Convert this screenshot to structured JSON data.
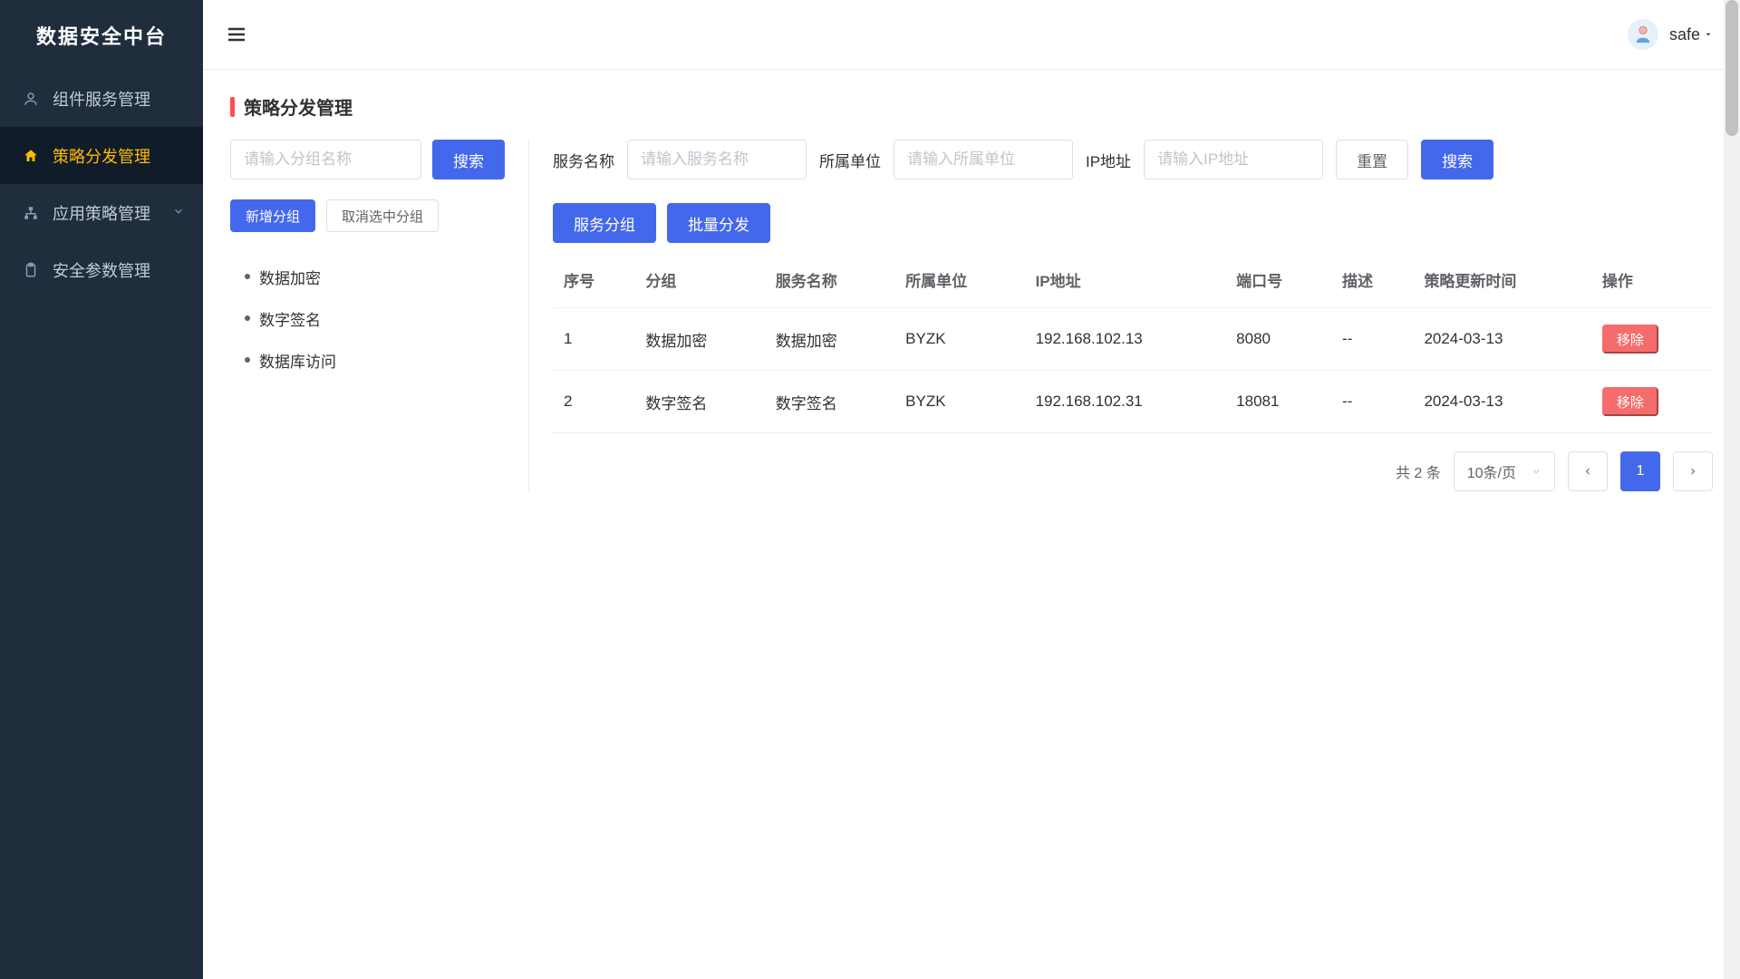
{
  "app_title": "数据安全中台",
  "user": {
    "name": "safe"
  },
  "sidebar": {
    "items": [
      {
        "label": "组件服务管理",
        "icon": "users-icon",
        "active": false,
        "expandable": false
      },
      {
        "label": "策略分发管理",
        "icon": "home-icon",
        "active": true,
        "expandable": false
      },
      {
        "label": "应用策略管理",
        "icon": "sitemap-icon",
        "active": false,
        "expandable": true
      },
      {
        "label": "安全参数管理",
        "icon": "clipboard-icon",
        "active": false,
        "expandable": false
      }
    ]
  },
  "page_title": "策略分发管理",
  "left_panel": {
    "search_placeholder": "请输入分组名称",
    "search_button": "搜索",
    "add_button": "新增分组",
    "cancel_button": "取消选中分组",
    "groups": [
      {
        "label": "数据加密"
      },
      {
        "label": "数字签名"
      },
      {
        "label": "数据库访问"
      }
    ]
  },
  "filters": {
    "service_label": "服务名称",
    "service_placeholder": "请输入服务名称",
    "unit_label": "所属单位",
    "unit_placeholder": "请输入所属单位",
    "ip_label": "IP地址",
    "ip_placeholder": "请输入IP地址",
    "reset_button": "重置",
    "search_button": "搜索"
  },
  "actions": {
    "group_service_button": "服务分组",
    "bulk_dispatch_button": "批量分发"
  },
  "table": {
    "headers": [
      "序号",
      "分组",
      "服务名称",
      "所属单位",
      "IP地址",
      "端口号",
      "描述",
      "策略更新时间",
      "操作"
    ],
    "rows": [
      {
        "seq": "1",
        "group": "数据加密",
        "service": "数据加密",
        "unit": "BYZK",
        "ip": "192.168.102.13",
        "port": "8080",
        "desc": "--",
        "updated": "2024-03-13",
        "op": "移除"
      },
      {
        "seq": "2",
        "group": "数字签名",
        "service": "数字签名",
        "unit": "BYZK",
        "ip": "192.168.102.31",
        "port": "18081",
        "desc": "--",
        "updated": "2024-03-13",
        "op": "移除"
      }
    ]
  },
  "pagination": {
    "total_text": "共 2 条",
    "page_size_label": "10条/页",
    "current_page": "1"
  }
}
